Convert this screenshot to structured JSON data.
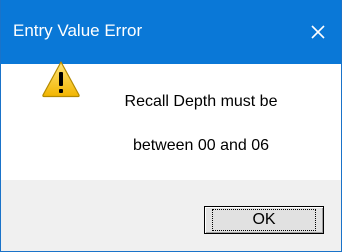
{
  "window": {
    "title": "Entry Value Error",
    "close_icon": "close-icon",
    "titlebar_color": "#0a78d7"
  },
  "message": {
    "icon": "warning-icon",
    "line1": "Recall Depth must be",
    "line2": "between 00 and 06"
  },
  "buttons": {
    "ok_label": "OK"
  }
}
